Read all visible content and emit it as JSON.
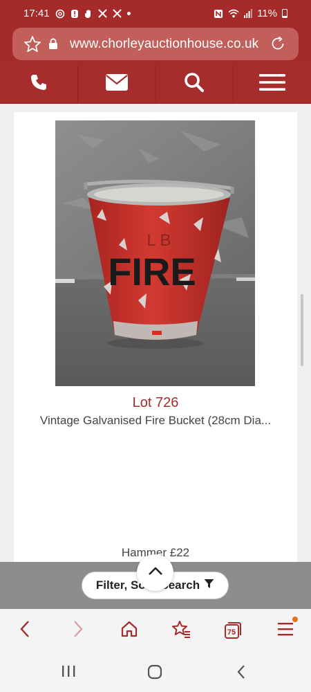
{
  "status_bar": {
    "time": "17:41",
    "battery_text": "11%",
    "left_icons": [
      "threads-icon",
      "alert-icon",
      "hand-icon",
      "x-icon",
      "x-icon",
      "dot-icon"
    ],
    "right_icons": [
      "nfc-icon",
      "wifi-icon",
      "signal-icon",
      "battery-icon"
    ]
  },
  "browser": {
    "url": "www.chorleyauctionhouse.co.uk",
    "tab_count": "75"
  },
  "site_nav": {
    "items": [
      "phone-icon",
      "envelope-icon",
      "search-icon",
      "menu-icon"
    ]
  },
  "lot": {
    "number": "Lot 726",
    "title": "Vintage Galvanised Fire Bucket (28cm Dia...",
    "hammer": "Hammer £22",
    "image_markings": {
      "top": "L B",
      "main": "FIRE"
    }
  },
  "filter": {
    "label": "Filter, Sort, Search"
  },
  "colors": {
    "brand": "#a52a2a",
    "url_bar": "#c25f5b",
    "bucket_red": "#c8302b",
    "badge": "#e8711a"
  }
}
